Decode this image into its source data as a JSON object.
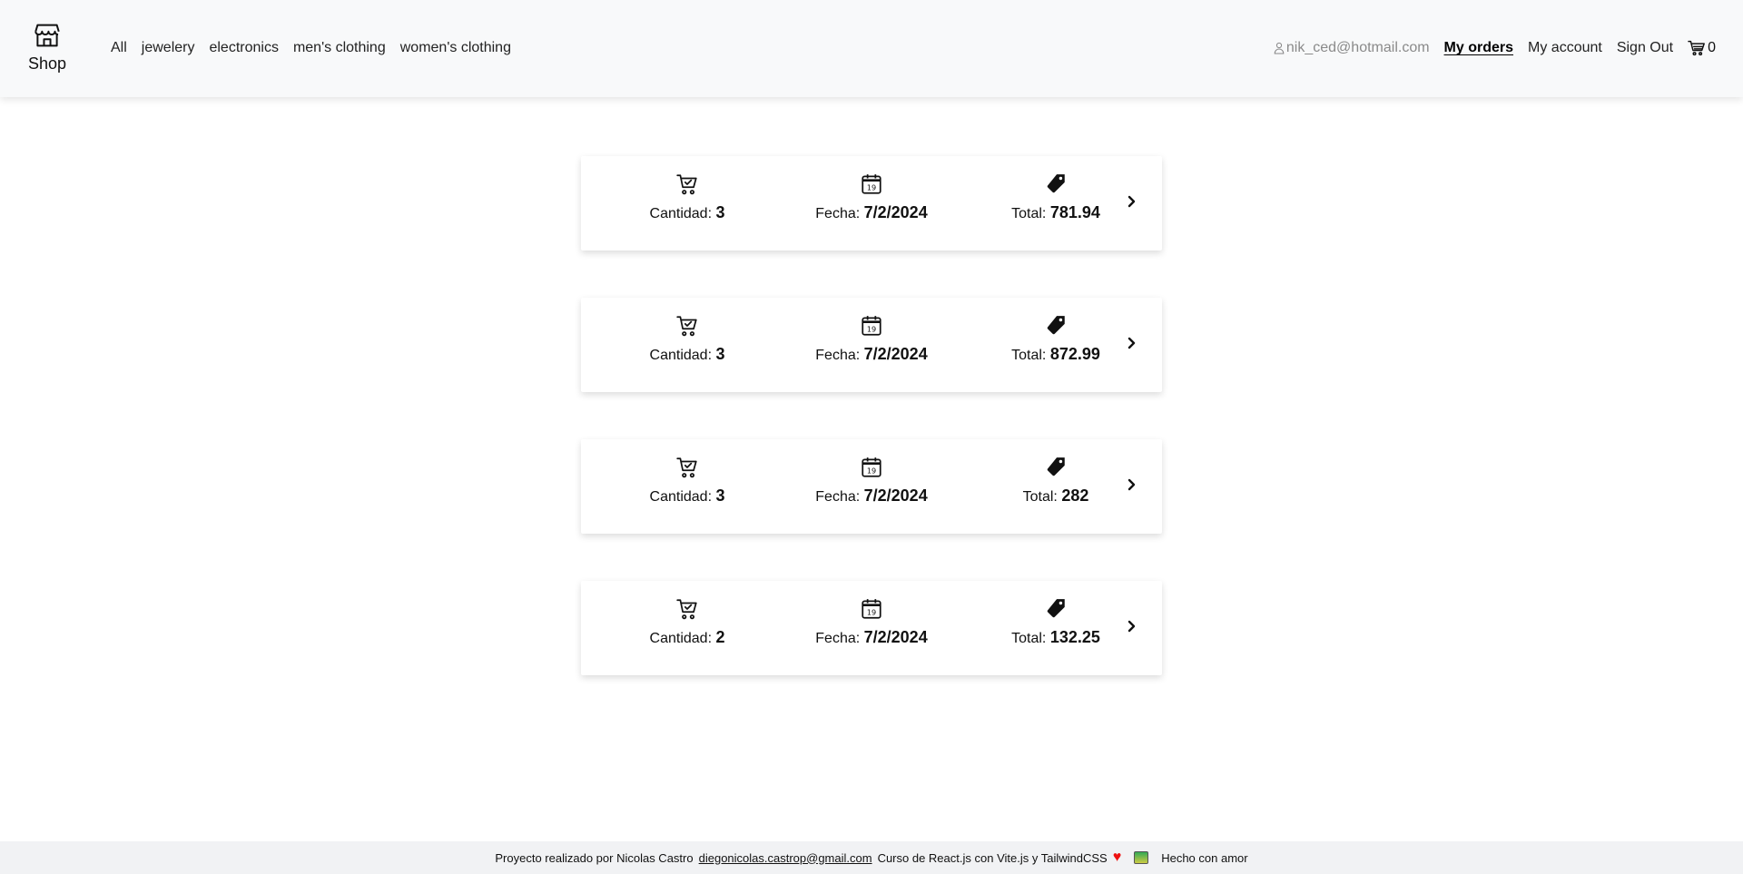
{
  "header": {
    "brand_label": "Shop",
    "brand_icon": "storefront-icon",
    "categories": [
      "All",
      "jewelery",
      "electronics",
      "men's clothing",
      "women's clothing"
    ],
    "user_email": "nik_ced@hotmail.com",
    "my_orders": "My orders",
    "my_account": "My account",
    "sign_out": "Sign Out",
    "cart_count": "0"
  },
  "orders": [
    {
      "quantity_label": "Cantidad:",
      "quantity": "3",
      "date_label": "Fecha:",
      "date": "7/2/2024",
      "total_label": "Total:",
      "total": "781.94"
    },
    {
      "quantity_label": "Cantidad:",
      "quantity": "3",
      "date_label": "Fecha:",
      "date": "7/2/2024",
      "total_label": "Total:",
      "total": "872.99"
    },
    {
      "quantity_label": "Cantidad:",
      "quantity": "3",
      "date_label": "Fecha:",
      "date": "7/2/2024",
      "total_label": "Total:",
      "total": "282"
    },
    {
      "quantity_label": "Cantidad:",
      "quantity": "2",
      "date_label": "Fecha:",
      "date": "7/2/2024",
      "total_label": "Total:",
      "total": "132.25"
    }
  ],
  "footer": {
    "credit": "Proyecto realizado por Nicolas Castro",
    "email": "diegonicolas.castrop@gmail.com",
    "course": "Curso de React.js con Vite.js y TailwindCSS",
    "made_with": "Hecho con amor"
  },
  "colors": {
    "header_bg": "#f8f9fa",
    "footer_bg": "#f1f2f4",
    "heart": "#ee1111"
  }
}
